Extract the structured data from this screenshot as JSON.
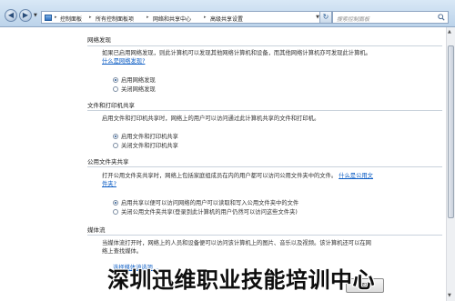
{
  "toolbar": {
    "breadcrumbs": [
      "控制面板",
      "所有控制面板项",
      "网络和共享中心",
      "高级共享设置"
    ],
    "search_placeholder": "搜索控制面板"
  },
  "sections": [
    {
      "title": "网络发现",
      "desc": "如果已启用网络发现，则此计算机可以发现其他网络计算机和设备，而其他网络计算机亦可发现此计算机。",
      "link": "什么是网络发现?",
      "options": [
        "启用网络发现",
        "关闭网络发现"
      ]
    },
    {
      "title": "文件和打印机共享",
      "desc": "启用文件和打印机共享时，网络上的用户可以访问通过此计算机共享的文件和打印机。",
      "options": [
        "启用文件和打印机共享",
        "关闭文件和打印机共享"
      ]
    },
    {
      "title": "公用文件夹共享",
      "desc": "打开公用文件夹共享时，网络上包括家庭组成员在内的用户都可以访问公用文件夹中的文件。",
      "link": "什么是公用文件夹?",
      "options": [
        "启用共享以便可以访问网络的用户可以读取和写入公用文件夹中的文件",
        "关闭公用文件夹共享(登录到此计算机的用户仍然可以访问这些文件夹)"
      ]
    },
    {
      "title": "媒体流",
      "desc": "当媒体流打开时，网络上的人员和设备便可以访问该计算机上的图片、音乐以及视频。该计算机还可以在网络上查找媒体。",
      "options": [
        "选择媒体流选项..."
      ]
    }
  ],
  "save_button": "保存",
  "watermark": "深圳迅维职业技能培训中心",
  "colors": {
    "link": "#0b5cc4",
    "titlebar": "#c9dcef"
  },
  "icons": [
    "back-arrow-icon",
    "forward-arrow-icon",
    "control-panel-icon",
    "refresh-icon",
    "search-icon"
  ]
}
